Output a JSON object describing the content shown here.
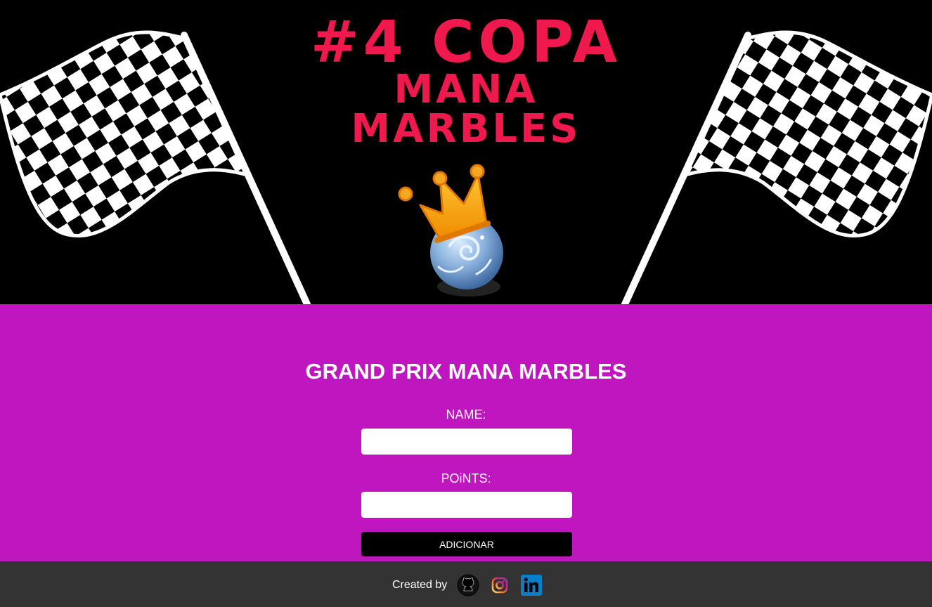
{
  "banner": {
    "title_line1": "#4 COPA",
    "title_line2": "MANA",
    "title_line3": "MARBLES",
    "title_color": "#f0194e",
    "logo_icon": "crown-marble-icon",
    "left_flag_icon": "checkered-flag-icon",
    "right_flag_icon": "checkered-flag-icon"
  },
  "form": {
    "title": "GRAND PRIX MANA MARBLES",
    "name_label": "NAME:",
    "name_value": "",
    "points_label": "POiNTS:",
    "points_value": "",
    "submit_label": "ADICIONAR",
    "background_color": "#bf16bf"
  },
  "footer": {
    "created_by": "Created by",
    "links": [
      {
        "icon": "github-icon"
      },
      {
        "icon": "instagram-icon"
      },
      {
        "icon": "linkedin-icon"
      }
    ],
    "background_color": "#333333"
  }
}
